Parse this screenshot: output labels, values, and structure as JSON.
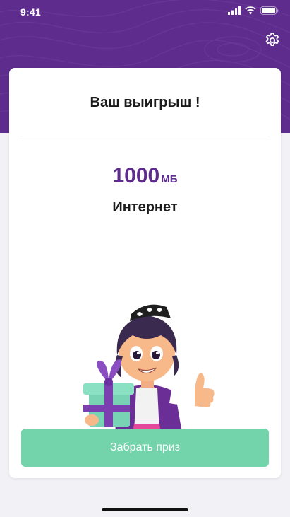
{
  "status_bar": {
    "time": "9:41"
  },
  "header": {
    "settings_icon": "gear-icon",
    "background_color": "#5d2c8c"
  },
  "card": {
    "title": "Ваш выигрыш !",
    "prize": {
      "amount": "1000",
      "unit": "МБ",
      "name": "Интернет"
    },
    "claim_button_label": "Забрать приз"
  },
  "colors": {
    "brand_purple": "#5d2c8c",
    "button_green": "#73d3aa",
    "page_background": "#f1f1f6"
  }
}
